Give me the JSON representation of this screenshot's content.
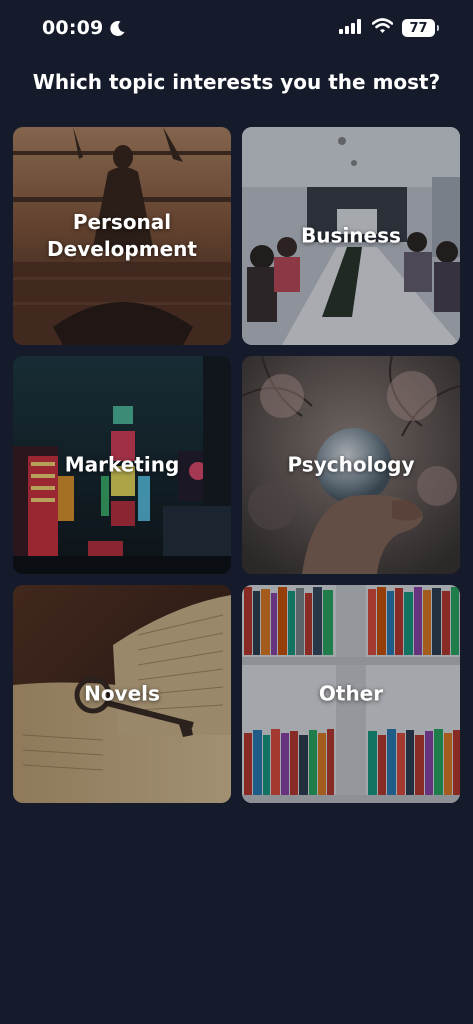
{
  "status_bar": {
    "time": "00:09",
    "battery": "77",
    "icons": [
      "moon-icon",
      "signal-icon",
      "wifi-icon",
      "battery-icon"
    ]
  },
  "page": {
    "title": "Which topic interests you the most?"
  },
  "topics": [
    {
      "label_line1": "Personal",
      "label_line2": "Development",
      "image": "meditation-sunset-image"
    },
    {
      "label": "Business",
      "image": "meeting-room-image"
    },
    {
      "label": "Marketing",
      "image": "city-billboards-image"
    },
    {
      "label": "Psychology",
      "image": "crystal-ball-hand-image"
    },
    {
      "label": "Novels",
      "image": "open-book-key-image"
    },
    {
      "label": "Other",
      "image": "bookshelf-image"
    }
  ],
  "colors": {
    "background": "#151b2a",
    "text": "#ffffff"
  }
}
